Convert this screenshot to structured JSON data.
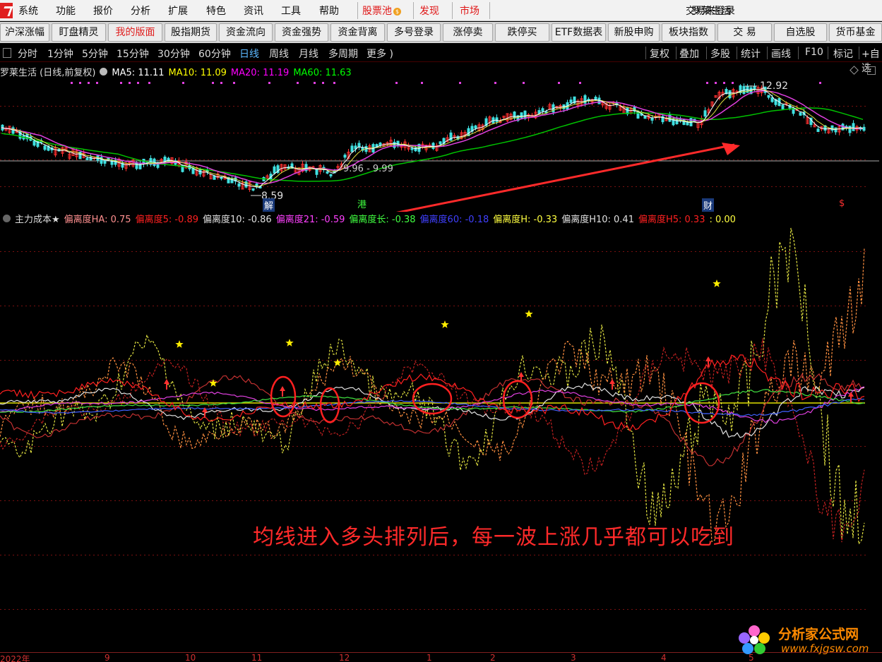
{
  "menu": {
    "items": [
      "系统",
      "功能",
      "报价",
      "分析",
      "扩展",
      "特色",
      "资讯",
      "工具",
      "帮助"
    ],
    "special": [
      "股票池",
      "发现",
      "市场"
    ],
    "status": "交易未登录",
    "stock": "罗莱生活"
  },
  "toolbar": {
    "buttons": [
      "沪深涨幅",
      "盯盘精灵",
      "我的版面",
      "股指期货",
      "资金流向",
      "资金强势",
      "资金背离",
      "多号登录",
      "涨停卖",
      "跌停买",
      "ETF数据表",
      "新股申购",
      "板块指数",
      "交 易",
      "自选股",
      "货币基金"
    ]
  },
  "period_tabs": [
    "分时",
    "1分钟",
    "5分钟",
    "15分钟",
    "30分钟",
    "60分钟",
    "日线",
    "周线",
    "月线",
    "多周期",
    "更多 )"
  ],
  "right_tools": [
    "复权",
    "叠加",
    "多股",
    "统计",
    "画线",
    "F10",
    "标记",
    "+自选"
  ],
  "main_chart": {
    "title": "罗莱生活 (日线,前复权)",
    "ma": [
      {
        "label": "MA5: 11.11",
        "color": "#ffffff"
      },
      {
        "label": "MA10: 11.09",
        "color": "#ffff00"
      },
      {
        "label": "MA20: 11.19",
        "color": "#ff00ff"
      },
      {
        "label": "MA60: 11.63",
        "color": "#00ff00"
      }
    ],
    "high_label": "12.92",
    "low_label": "8.59",
    "range_label": "9.96 - 9.99",
    "markers": [
      "解",
      "港",
      "财",
      "$"
    ]
  },
  "indicator": {
    "title": "主力成本★",
    "values": [
      {
        "label": "偏离度HA: 0.75",
        "color": "#ff9090"
      },
      {
        "label": "偏离度5: -0.89",
        "color": "#ff2020"
      },
      {
        "label": "偏离度10: -0.86",
        "color": "#e0e0e0"
      },
      {
        "label": "偏离度21: -0.59",
        "color": "#ff40ff"
      },
      {
        "label": "偏离度长: -0.38",
        "color": "#40ff40"
      },
      {
        "label": "偏离度60: -0.18",
        "color": "#4040ff"
      },
      {
        "label": "偏离度H: -0.33",
        "color": "#ffff40"
      },
      {
        "label": "偏离度H10: 0.41",
        "color": "#e0e0e0"
      },
      {
        "label": "偏离度H5: 0.33",
        "color": "#ff2020"
      },
      {
        "label": ": 0.00",
        "color": "#ffff40"
      }
    ]
  },
  "annotation": "均线进入多头排列后，每一波上涨几乎都可以吃到",
  "date_axis": [
    "2022年",
    "9",
    "10",
    "11",
    "12",
    "1",
    "2",
    "3",
    "4",
    "5"
  ],
  "watermark": {
    "name": "分析家公式网",
    "url": "www.fxjgsw.com"
  }
}
